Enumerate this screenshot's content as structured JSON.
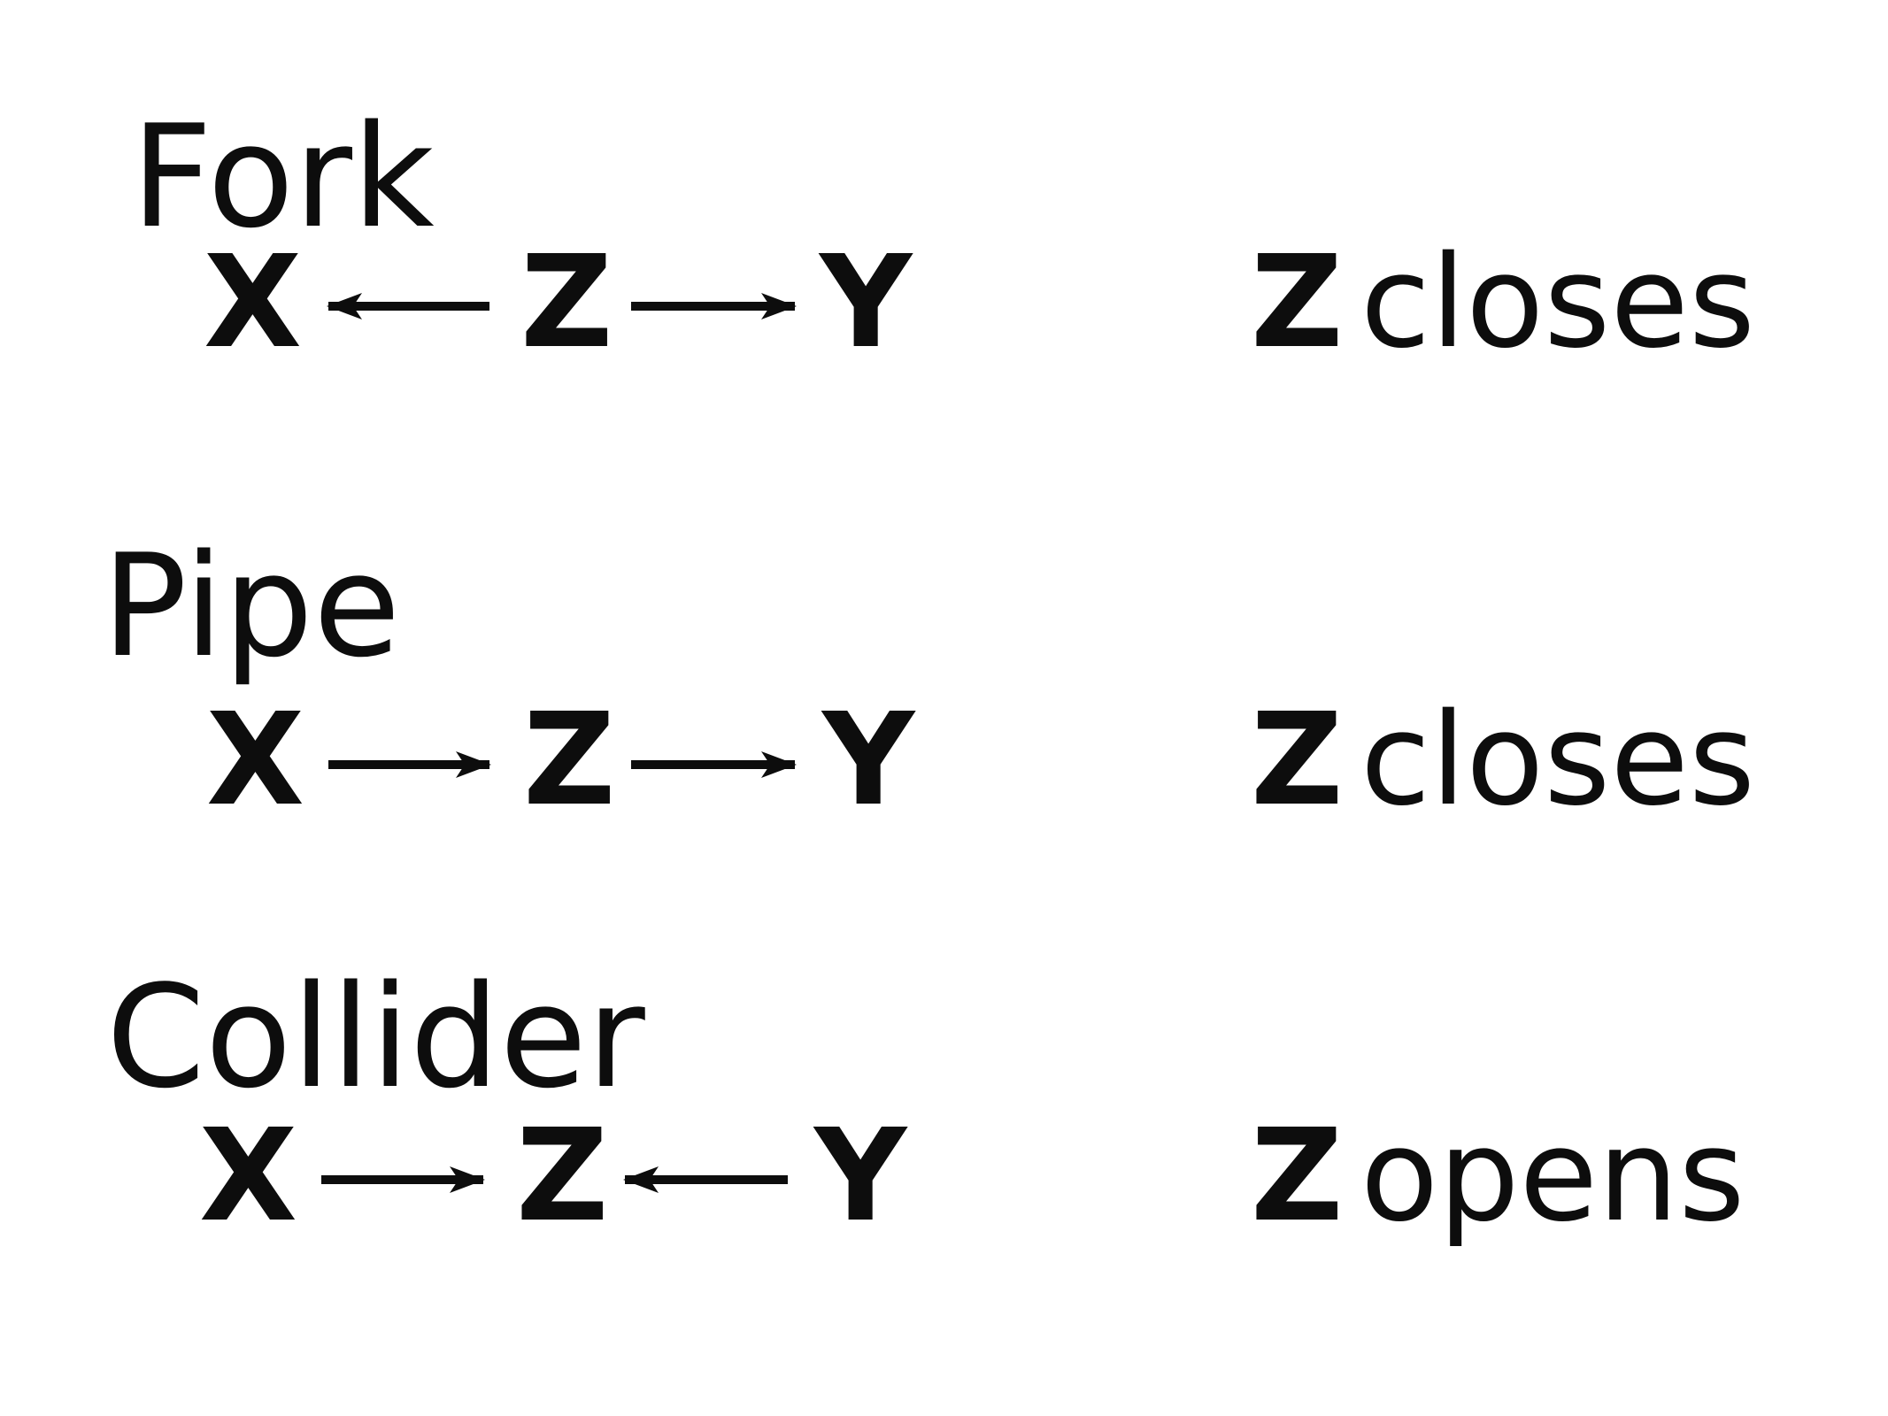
{
  "diagrams": [
    {
      "title": "Fork",
      "nodes": [
        "X",
        "Z",
        "Y"
      ],
      "edges": [
        {
          "from": "Z",
          "to": "X"
        },
        {
          "from": "Z",
          "to": "Y"
        }
      ],
      "result_var": "Z",
      "result_word": "closes"
    },
    {
      "title": "Pipe",
      "nodes": [
        "X",
        "Z",
        "Y"
      ],
      "edges": [
        {
          "from": "X",
          "to": "Z"
        },
        {
          "from": "Z",
          "to": "Y"
        }
      ],
      "result_var": "Z",
      "result_word": "closes"
    },
    {
      "title": "Collider",
      "nodes": [
        "X",
        "Z",
        "Y"
      ],
      "edges": [
        {
          "from": "X",
          "to": "Z"
        },
        {
          "from": "Y",
          "to": "Z"
        }
      ],
      "result_var": "Z",
      "result_word": "opens"
    }
  ]
}
